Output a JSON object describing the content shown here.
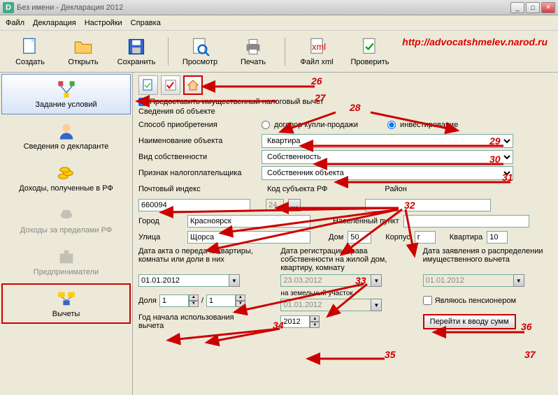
{
  "window": {
    "title": "Без имени - Декларация 2012"
  },
  "menu": {
    "file": "Файл",
    "decl": "Декларация",
    "settings": "Настройки",
    "help": "Справка"
  },
  "toolbar": {
    "create": "Создать",
    "open": "Открыть",
    "save": "Сохранить",
    "preview": "Просмотр",
    "print": "Печать",
    "xml": "Файл xml",
    "check": "Проверить"
  },
  "url": "http://advocatshmelev.narod.ru",
  "sidebar": {
    "conditions": "Задание условий",
    "declarant": "Сведения о декларанте",
    "income_rf": "Доходы, полученные в РФ",
    "income_abroad": "Доходы за пределами РФ",
    "entrepreneurs": "Предприниматели",
    "deductions": "Вычеты"
  },
  "form": {
    "provide_deduct": "Предоставить имущественный налоговый вычет",
    "obj_info": "Сведения об объекте",
    "acq_method": "Способ приобретения",
    "contract": "договор купли-продажи",
    "investment": "инвестирование",
    "obj_name": "Наименование объекта",
    "obj_name_val": "Квартира",
    "ownership": "Вид собственности",
    "ownership_val": "Собственность",
    "taxpayer_attr": "Признак налогоплательщика",
    "taxpayer_val": "Собственник объекта",
    "postal": "Почтовый индекс",
    "postal_val": "660094",
    "subj_code": "Код субъекта РФ",
    "subj_val": "24",
    "district": "Район",
    "city": "Город",
    "city_val": "Красноярск",
    "locality": "Населенный пункт",
    "street": "Улица",
    "street_val": "Щорса",
    "house": "Дом",
    "house_val": "50",
    "building": "Корпус",
    "building_val": "г",
    "flat": "Квартира",
    "flat_val": "10",
    "act_date": "Дата акта о передаче квартиры, комнаты или доли в них",
    "reg_date": "Дата регистрации права собственности на жилой дом, квартиру, комнату",
    "dist_date": "Дата заявления о распределении имущественного вычета",
    "act_val": "01.01.2012",
    "reg_val": "23.03.2012",
    "dist_val": "01.01.2012",
    "land_plot": "на земельный участок",
    "share": "Доля",
    "share_a": "1",
    "share_b": "1",
    "land_val": "01.01.2012",
    "pensioner": "Являюсь пенсионером",
    "year_start": "Год начала использования вычета",
    "year_val": "2012",
    "go_sums": "Перейти к вводу сумм"
  },
  "annotations": {
    "n26": "26",
    "n27": "27",
    "n28": "28",
    "n29": "29",
    "n30": "30",
    "n31": "31",
    "n32": "32",
    "n33": "33",
    "n34": "34",
    "n35": "35",
    "n36": "36",
    "n37": "37"
  }
}
